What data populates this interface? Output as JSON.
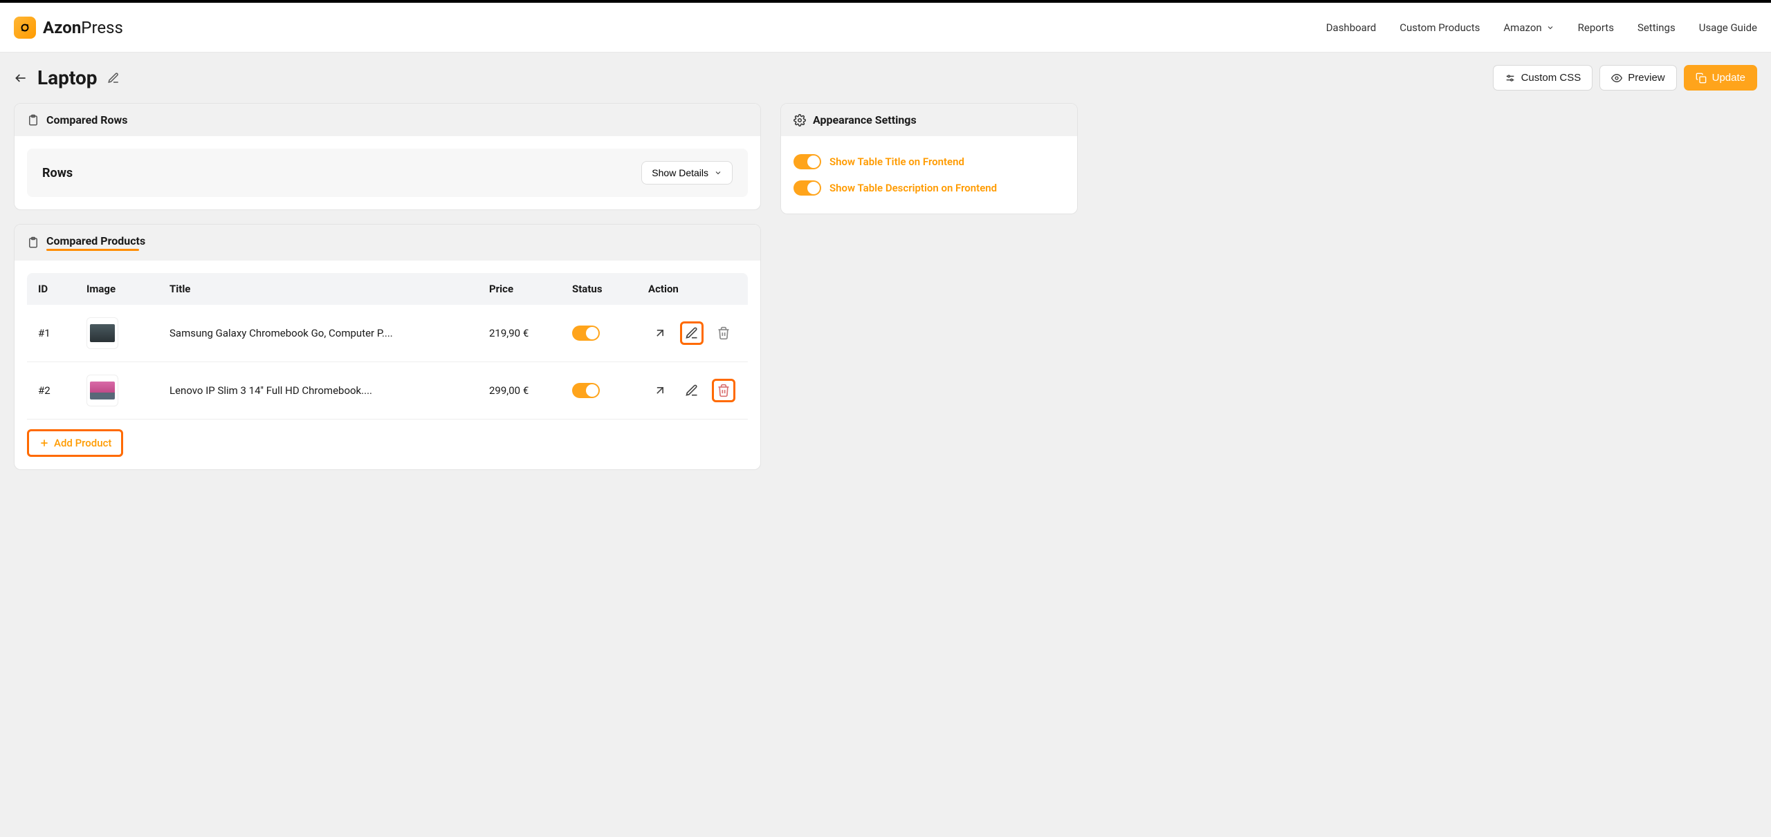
{
  "brand": {
    "name_bold": "Azon",
    "name_light": "Press"
  },
  "nav": {
    "dashboard": "Dashboard",
    "custom_products": "Custom Products",
    "amazon": "Amazon",
    "reports": "Reports",
    "settings": "Settings",
    "usage_guide": "Usage Guide"
  },
  "page": {
    "title": "Laptop",
    "custom_css": "Custom CSS",
    "preview": "Preview",
    "update": "Update"
  },
  "compared_rows": {
    "header": "Compared Rows",
    "rows_label": "Rows",
    "show_details": "Show Details"
  },
  "compared_products": {
    "header": "Compared Products",
    "columns": {
      "id": "ID",
      "image": "Image",
      "title": "Title",
      "price": "Price",
      "status": "Status",
      "action": "Action"
    },
    "rows": [
      {
        "id": "#1",
        "title": "Samsung Galaxy Chromebook Go, Computer P....",
        "price": "219,90 €"
      },
      {
        "id": "#2",
        "title": "Lenovo IP Slim 3 14'' Full HD Chromebook....",
        "price": "299,00 €"
      }
    ],
    "add_product": "Add Product"
  },
  "appearance": {
    "header": "Appearance Settings",
    "show_title": "Show Table Title on Frontend",
    "show_description": "Show Table Description on Frontend"
  }
}
